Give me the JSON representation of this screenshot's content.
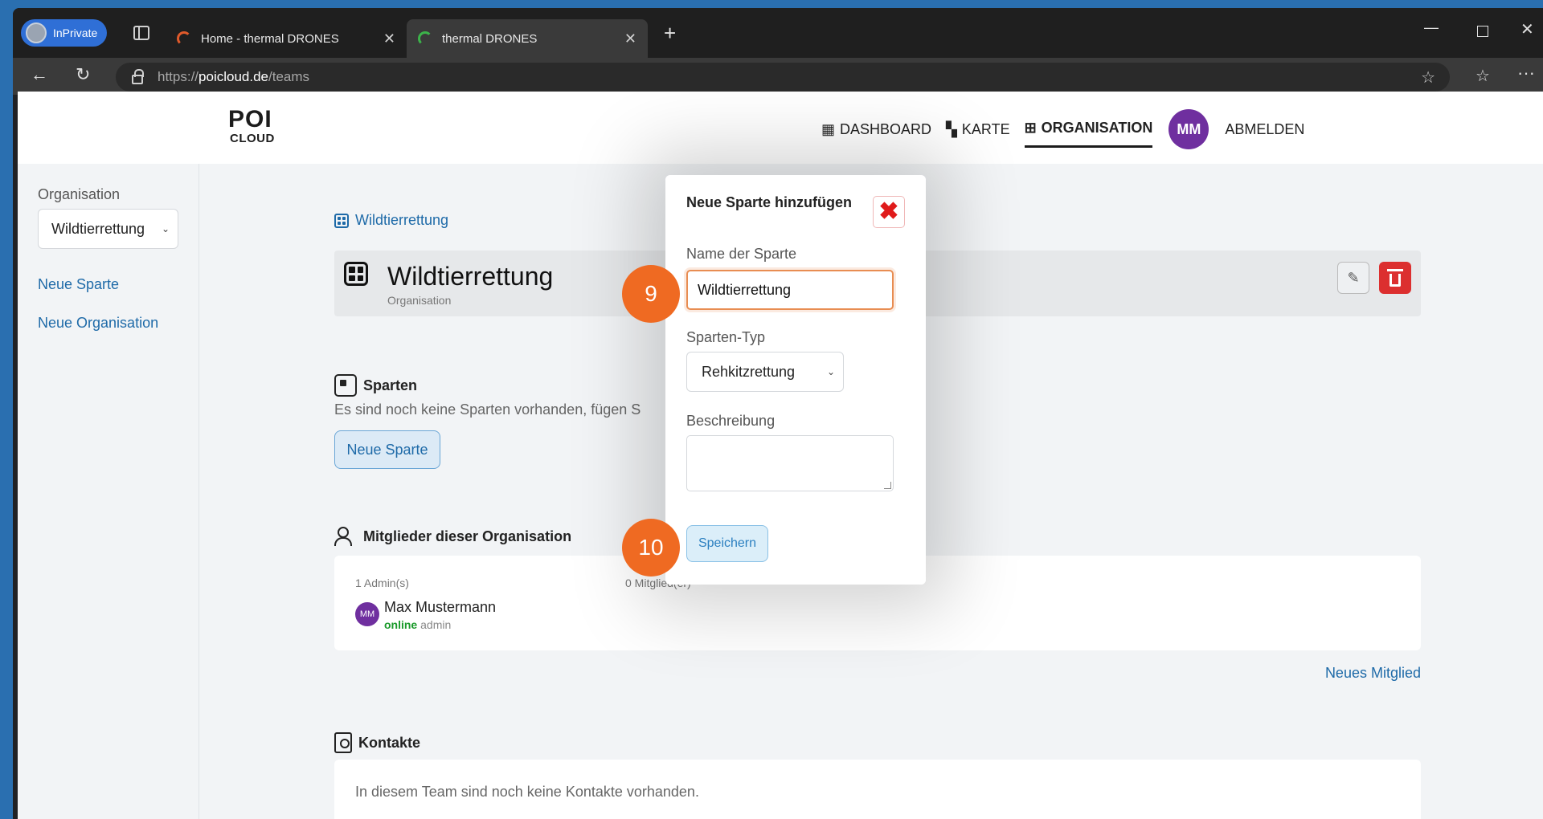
{
  "browser": {
    "profile_label": "InPrivate",
    "tabs": [
      {
        "title": "Home - thermal DRONES",
        "active": false
      },
      {
        "title": "thermal DRONES",
        "active": true
      }
    ],
    "url_prefix": "https://",
    "url_host": "poicloud.de",
    "url_path": "/teams"
  },
  "header": {
    "logo_top": "POI",
    "logo_bottom": "CLOUD",
    "nav": [
      {
        "label": "DASHBOARD",
        "icon": "calendar-icon"
      },
      {
        "label": "KARTE",
        "icon": "map-icon"
      },
      {
        "label": "ORGANISATION",
        "icon": "grid-icon",
        "active": true
      }
    ],
    "user_initials": "MM",
    "logout_label": "ABMELDEN"
  },
  "sidebar": {
    "label": "Organisation",
    "selected_org": "Wildtierrettung",
    "links": [
      "Neue Sparte",
      "Neue Organisation"
    ]
  },
  "main": {
    "breadcrumb": "Wildtierrettung",
    "org_name": "Wildtierrettung",
    "org_type": "Organisation",
    "sparten": {
      "title": "Sparten",
      "empty_text": "Es sind noch keine Sparten vorhanden, fügen S",
      "button_label": "Neue Sparte"
    },
    "members": {
      "title": "Mitglieder dieser Organisation",
      "admins_count": "1 Admin(s)",
      "members_count": "0 Mitglied(er)",
      "list": [
        {
          "initials": "MM",
          "name": "Max Mustermann",
          "status": "online",
          "role": "admin"
        }
      ],
      "add_link": "Neues Mitglied"
    },
    "contacts": {
      "title": "Kontakte",
      "empty_text": "In diesem Team sind noch keine Kontakte vorhanden."
    }
  },
  "modal": {
    "title": "Neue Sparte hinzufügen",
    "name_label": "Name der Sparte",
    "name_value": "Wildtierrettung",
    "type_label": "Sparten-Typ",
    "type_value": "Rehkitzrettung",
    "description_label": "Beschreibung",
    "description_value": "",
    "save_label": "Speichern"
  },
  "step_markers": [
    "9",
    "10"
  ],
  "colors": {
    "accent_link": "#1e6aa8",
    "step_marker": "#ef6a22",
    "delete": "#dc2f2f",
    "avatar": "#6f2f9f",
    "online": "#1a9a2a"
  }
}
